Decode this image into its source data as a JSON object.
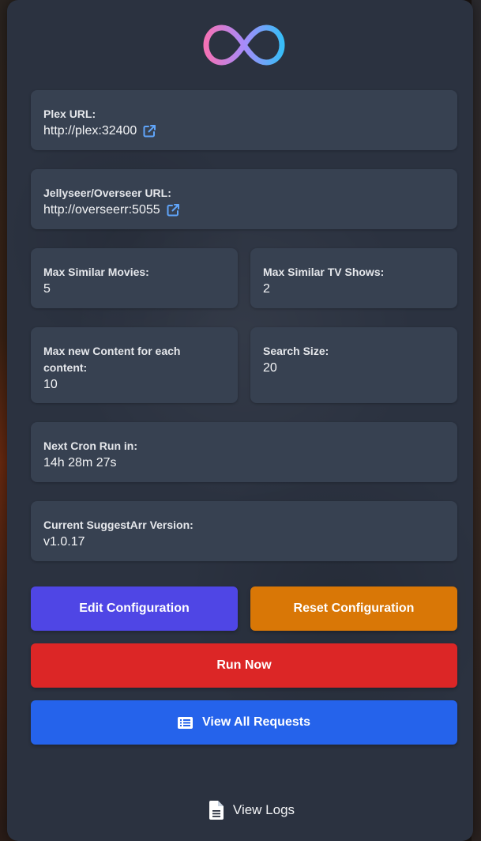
{
  "plex": {
    "label": "Plex URL:",
    "value": "http://plex:32400"
  },
  "overseer": {
    "label": "Jellyseer/Overseer URL:",
    "value": "http://overseerr:5055"
  },
  "max_movies": {
    "label": "Max Similar Movies:",
    "value": "5"
  },
  "max_tv": {
    "label": "Max Similar TV Shows:",
    "value": "2"
  },
  "max_content": {
    "label": "Max new Content for each content:",
    "value": "10"
  },
  "search_size": {
    "label": "Search Size:",
    "value": "20"
  },
  "cron": {
    "label": "Next Cron Run in:",
    "value": "14h 28m 27s"
  },
  "version": {
    "label": "Current SuggestArr Version:",
    "value": "v1.0.17"
  },
  "buttons": {
    "edit": "Edit Configuration",
    "reset": "Reset Configuration",
    "run": "Run Now",
    "view_requests": "View All Requests",
    "view_logs": "View Logs"
  },
  "icons": {
    "logo": "infinity-logo",
    "external": "external-link-icon",
    "list": "list-icon",
    "file": "file-icon"
  },
  "colors": {
    "edit": "#4f46e5",
    "reset": "#d97706",
    "run": "#dc2626",
    "view": "#2563eb",
    "link_icon": "#60a5fa"
  }
}
